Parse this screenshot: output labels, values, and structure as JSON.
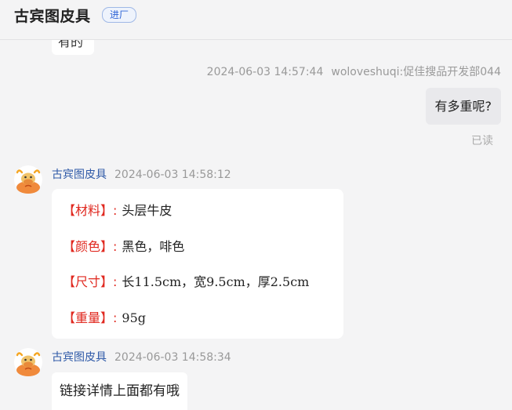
{
  "header": {
    "title": "古宾图皮具",
    "badge": "进厂"
  },
  "cut_message": {
    "text": "有的"
  },
  "outgoing": {
    "timestamp": "2024-06-03 14:57:44",
    "sender": "woloveshuqi:促佳搜品开发部044",
    "text": "有多重呢?",
    "read_status": "已读"
  },
  "incoming_1": {
    "name": "古宾图皮具",
    "timestamp": "2024-06-03 14:58:12",
    "specs": [
      {
        "key": "【材料】:",
        "value": "头层牛皮"
      },
      {
        "key": "【颜色】:",
        "value": "黑色，啡色"
      },
      {
        "key": "【尺寸】:",
        "value": "长11.5cm，宽9.5cm，厚2.5cm"
      },
      {
        "key": "【重量】:",
        "value": "95g"
      }
    ]
  },
  "incoming_2": {
    "name": "古宾图皮具",
    "timestamp": "2024-06-03 14:58:34",
    "text": "链接详情上面都有哦"
  },
  "colors": {
    "spec_key": "#e0281f",
    "sender_name": "#2f5aa8",
    "badge": "#2e64d6"
  },
  "icons": {
    "avatar": "bull-mascot-avatar-icon"
  }
}
